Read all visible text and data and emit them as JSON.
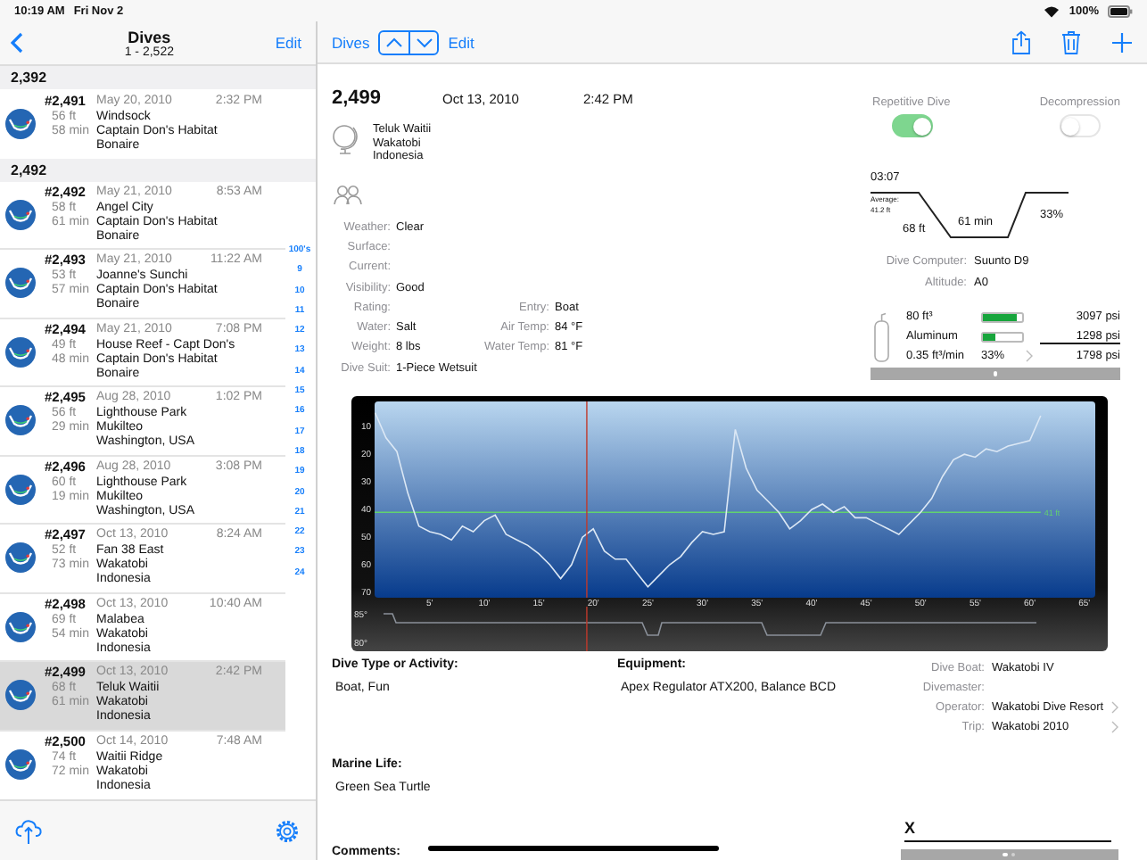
{
  "status_bar": {
    "time": "10:19 AM",
    "date": "Fri Nov 2",
    "battery": "100%"
  },
  "list_nav": {
    "title": "Dives",
    "subtitle": "1 - 2,522",
    "edit": "Edit"
  },
  "sections": [
    {
      "title": "2,392",
      "dives": [
        {
          "number": "#2,491",
          "date": "May 20, 2010",
          "time": "2:32 PM",
          "depth": "56 ft",
          "duration": "58 min",
          "place": [
            "Windsock",
            "Captain Don's Habitat",
            "Bonaire"
          ],
          "selected": false
        }
      ]
    },
    {
      "title": "2,492",
      "dives": [
        {
          "number": "#2,492",
          "date": "May 21, 2010",
          "time": "8:53 AM",
          "depth": "58 ft",
          "duration": "61 min",
          "place": [
            "Angel City",
            "Captain Don's Habitat",
            "Bonaire"
          ],
          "selected": false
        },
        {
          "number": "#2,493",
          "date": "May 21, 2010",
          "time": "11:22 AM",
          "depth": "53 ft",
          "duration": "57 min",
          "place": [
            "Joanne's Sunchi",
            "Captain Don's Habitat",
            "Bonaire"
          ],
          "selected": false
        },
        {
          "number": "#2,494",
          "date": "May 21, 2010",
          "time": "7:08 PM",
          "depth": "49 ft",
          "duration": "48 min",
          "place": [
            "House Reef - Capt Don's",
            "Captain Don's Habitat",
            "Bonaire"
          ],
          "selected": false
        },
        {
          "number": "#2,495",
          "date": "Aug 28, 2010",
          "time": "1:02 PM",
          "depth": "56 ft",
          "duration": "29 min",
          "place": [
            "Lighthouse Park",
            "Mukilteo",
            "Washington, USA"
          ],
          "selected": false
        },
        {
          "number": "#2,496",
          "date": "Aug 28, 2010",
          "time": "3:08 PM",
          "depth": "60 ft",
          "duration": "19 min",
          "place": [
            "Lighthouse Park",
            "Mukilteo",
            "Washington, USA"
          ],
          "selected": false
        },
        {
          "number": "#2,497",
          "date": "Oct 13, 2010",
          "time": "8:24 AM",
          "depth": "52 ft",
          "duration": "73 min",
          "place": [
            "Fan 38 East",
            "Wakatobi",
            "Indonesia"
          ],
          "selected": false
        },
        {
          "number": "#2,498",
          "date": "Oct 13, 2010",
          "time": "10:40 AM",
          "depth": "69 ft",
          "duration": "54 min",
          "place": [
            "Malabea",
            "Wakatobi",
            "Indonesia"
          ],
          "selected": false
        },
        {
          "number": "#2,499",
          "date": "Oct 13, 2010",
          "time": "2:42 PM",
          "depth": "68 ft",
          "duration": "61 min",
          "place": [
            "Teluk Waitii",
            "Wakatobi",
            "Indonesia"
          ],
          "selected": true
        },
        {
          "number": "#2,500",
          "date": "Oct 14, 2010",
          "time": "7:48 AM",
          "depth": "74 ft",
          "duration": "72 min",
          "place": [
            "Waitii Ridge",
            "Wakatobi",
            "Indonesia"
          ],
          "selected": false
        }
      ]
    }
  ],
  "index": [
    "100's",
    "9",
    "10",
    "11",
    "12",
    "13",
    "14",
    "15",
    "16",
    "17",
    "18",
    "19",
    "20",
    "21",
    "22",
    "23",
    "24"
  ],
  "detail_nav": {
    "back": "Dives",
    "edit": "Edit"
  },
  "dive": {
    "number": "2,499",
    "date": "Oct 13, 2010",
    "time": "2:42 PM",
    "location": [
      "Teluk Waitii",
      "Wakatobi",
      "Indonesia"
    ]
  },
  "conditions": [
    {
      "fields": [
        {
          "label": "Weather:",
          "value": "Clear"
        }
      ]
    },
    {
      "fields": [
        {
          "label": "Surface:"
        }
      ]
    },
    {
      "fields": [
        {
          "label": "Current:"
        }
      ]
    },
    {
      "fields": [
        {
          "label": "Visibility:",
          "value": "Good"
        }
      ]
    },
    {
      "fields": [
        {
          "label": "Rating:"
        },
        {
          "label": "Entry:",
          "value": "Boat"
        }
      ]
    },
    {
      "fields": [
        {
          "label": "Water:",
          "value": "Salt"
        },
        {
          "label": "Air Temp:",
          "value": "84 °F"
        }
      ]
    },
    {
      "fields": [
        {
          "label": "Weight:",
          "value": "8 lbs"
        },
        {
          "label": "Water Temp:",
          "value": "81 °F"
        }
      ]
    },
    {
      "fields": [
        {
          "label": "Dive Suit:",
          "value": "1-Piece Wetsuit"
        }
      ]
    }
  ],
  "toggles": [
    {
      "label": "Repetitive Dive",
      "on": true
    },
    {
      "label": "Decompression",
      "on": false
    }
  ],
  "profile": {
    "surface_interval": "03:07",
    "average_label": "Average:",
    "average": "41.2 ft",
    "max_depth": "68 ft",
    "duration": "61 min",
    "percent": "33%"
  },
  "computer": [
    {
      "label": "Dive Computer:",
      "value": "Suunto D9"
    },
    {
      "label": "Altitude:",
      "value": "A0"
    }
  ],
  "tank": {
    "size": "80 ft³",
    "material": "Aluminum",
    "rate": "0.35 ft³/min",
    "percent": "33%",
    "start": {
      "level": 0.88,
      "reading": "3097 psi"
    },
    "end": {
      "level": 0.32,
      "reading": "1298 psi"
    },
    "used": "1798 psi"
  },
  "depth_chart": {
    "chart_data": {
      "type": "line",
      "x": [
        0,
        1,
        2,
        3,
        4,
        5,
        6,
        7,
        8,
        9,
        10,
        11,
        12,
        13,
        14,
        15,
        16,
        17,
        18,
        19,
        20,
        21,
        22,
        23,
        24,
        25,
        26,
        27,
        28,
        29,
        30,
        31,
        32,
        33,
        34,
        35,
        36,
        37,
        38,
        39,
        40,
        41,
        42,
        43,
        44,
        45,
        46,
        47,
        48,
        49,
        50,
        51,
        52,
        53,
        54,
        55,
        56,
        57,
        58,
        59,
        60,
        61
      ],
      "series": [
        {
          "color": "#dce8f5",
          "values": [
            5,
            14,
            19,
            34,
            46,
            48,
            49,
            51,
            46,
            48,
            44,
            42,
            49,
            51,
            53,
            56,
            60,
            65,
            60,
            50,
            47,
            55,
            58,
            58,
            63,
            68,
            64,
            60,
            57,
            52,
            48,
            49,
            48,
            11,
            25,
            33,
            37,
            41,
            47,
            44,
            40,
            38,
            41,
            39,
            43,
            43,
            45,
            47,
            49,
            45,
            41,
            36,
            28,
            22,
            20,
            21,
            18,
            19,
            17,
            16,
            15,
            6
          ]
        }
      ],
      "xlim": [
        0,
        66
      ],
      "ylim": [
        72,
        0
      ],
      "xticks": [
        {
          "value": 5,
          "label": "5'"
        },
        {
          "value": 10,
          "label": "10'"
        },
        {
          "value": 15,
          "label": "15'"
        },
        {
          "value": 20,
          "label": "20'"
        },
        {
          "value": 25,
          "label": "25'"
        },
        {
          "value": 30,
          "label": "30'"
        },
        {
          "value": 35,
          "label": "35'"
        },
        {
          "value": 40,
          "label": "40'"
        },
        {
          "value": 45,
          "label": "45'"
        },
        {
          "value": 50,
          "label": "50'"
        },
        {
          "value": 55,
          "label": "55'"
        },
        {
          "value": 60,
          "label": "60'"
        },
        {
          "value": 65,
          "label": "65'"
        }
      ],
      "yticks": [
        10,
        20,
        30,
        40,
        50,
        60,
        70
      ],
      "ref_lines": [
        {
          "axis": "y",
          "value": 41,
          "label": "41 ft"
        },
        {
          "axis": "x",
          "value": 19.4,
          "color": "#c0392b"
        }
      ]
    }
  },
  "temperature_strip": {
    "labels": [
      "85°",
      "80°"
    ]
  },
  "activity": {
    "label": "Dive Type or Activity:",
    "value": "Boat, Fun"
  },
  "equipment": {
    "label": "Equipment:",
    "value": "Apex Regulator ATX200, Balance BCD"
  },
  "boat_info": [
    {
      "label": "Dive Boat:",
      "value": "Wakatobi IV",
      "link": false
    },
    {
      "label": "Divemaster:",
      "link": false
    },
    {
      "label": "Operator:",
      "value": "Wakatobi Dive Resort",
      "link": true
    },
    {
      "label": "Trip:",
      "value": "Wakatobi 2010",
      "link": true
    }
  ],
  "marine_life": {
    "label": "Marine Life:",
    "value": "Green Sea Turtle"
  },
  "signature": {
    "mark": "X"
  },
  "comments": {
    "label": "Comments:"
  }
}
